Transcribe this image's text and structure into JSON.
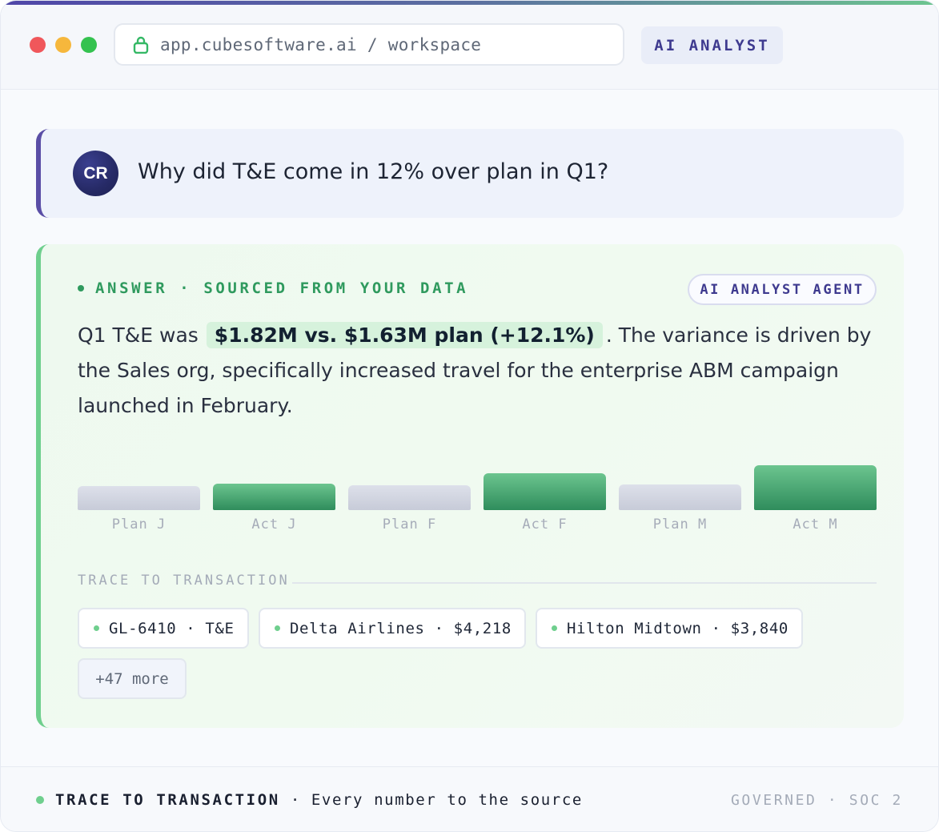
{
  "browser": {
    "url": "app.cubesoftware.ai / workspace",
    "badge": "AI ANALYST",
    "lock_icon": "lock-icon"
  },
  "question": {
    "avatar_initials": "CR",
    "text": "Why did T&E come in 12% over plan in Q1?"
  },
  "answer": {
    "label": "ANSWER · SOURCED FROM YOUR DATA",
    "agent_pill": "AI ANALYST AGENT",
    "text_before": "Q1 T&E was",
    "highlight": "$1.82M vs. $1.63M plan (+12.1%)",
    "text_after": ". The variance is driven by the Sales org, specifically increased travel for the enterprise ABM campaign launched in February."
  },
  "chart_data": {
    "type": "bar",
    "categories": [
      "Plan J",
      "Act J",
      "Plan F",
      "Act F",
      "Plan M",
      "Act M"
    ],
    "values": [
      30,
      33,
      31,
      46,
      32,
      56
    ],
    "kinds": [
      "plan",
      "act",
      "plan",
      "act",
      "plan",
      "act"
    ],
    "title": "",
    "xlabel": "",
    "ylabel": "",
    "ylim": [
      0,
      56
    ],
    "grid": false,
    "colors": {
      "plan": "#c7cbd8",
      "act": "#2f8d5c"
    }
  },
  "trace": {
    "heading": "TRACE TO TRANSACTION",
    "chips": [
      "GL-6410 · T&E",
      "Delta Airlines · $4,218",
      "Hilton Midtown · $3,840"
    ],
    "more": "+47 more"
  },
  "footer": {
    "strong": "TRACE TO TRANSACTION",
    "rest": " · Every number to the source",
    "right": "GOVERNED · SOC 2"
  },
  "colors": {
    "accent": "#5a4ea6",
    "success": "#6fcf8e",
    "text": "#1d2433"
  }
}
